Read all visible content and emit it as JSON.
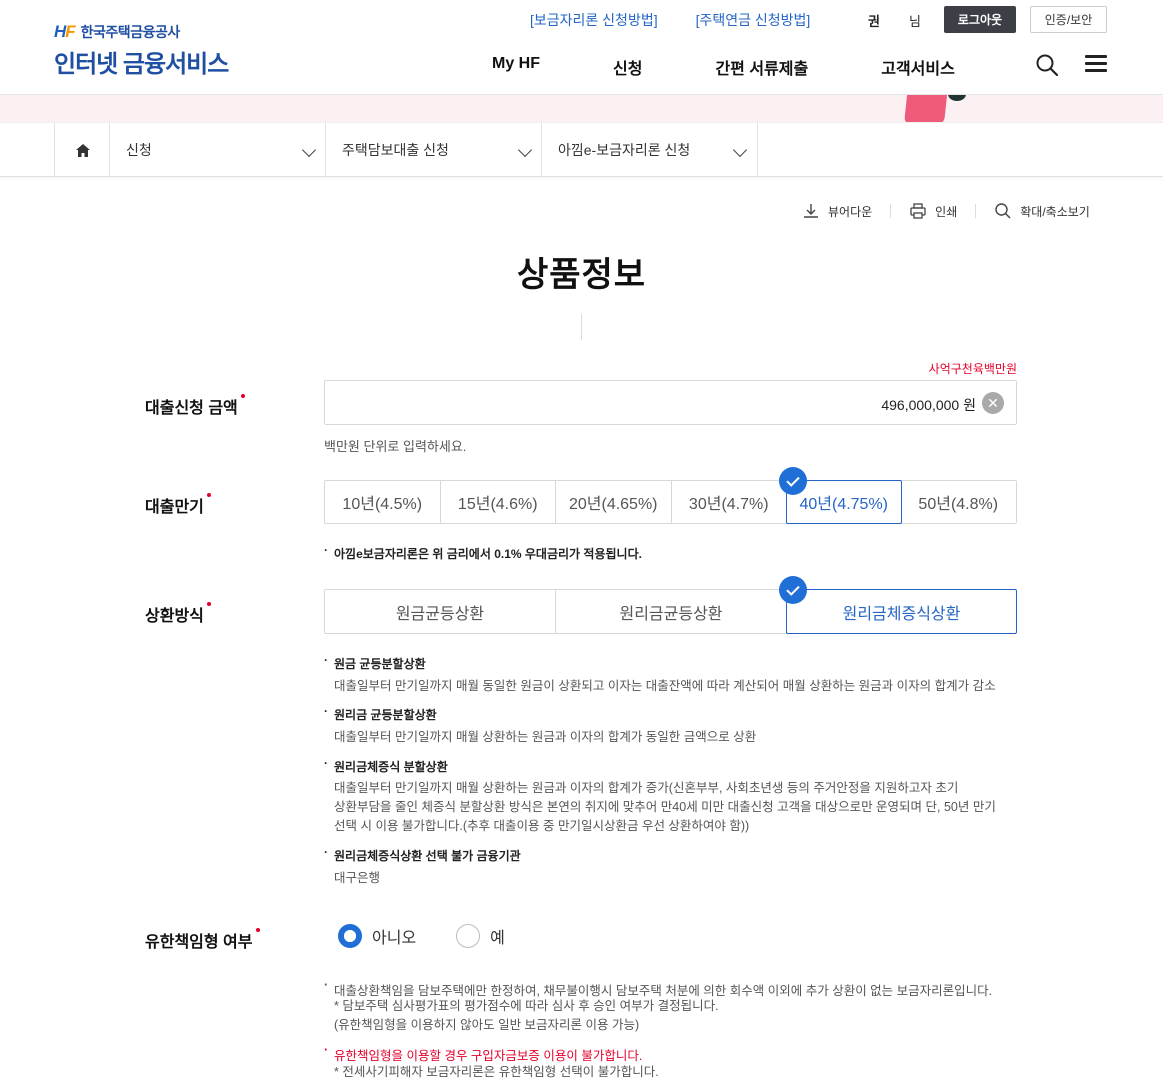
{
  "header": {
    "logo_org": "한국주택금융공사",
    "logo_main": "인터넷 금융서비스",
    "util_links": [
      "[보금자리론 신청방법]",
      "[주택연금 신청방법]"
    ],
    "user_name": "권",
    "user_suffix": "님",
    "logout_label": "로그아웃",
    "cert_label": "인증/보안",
    "gnb": [
      "My HF",
      "신청",
      "간편 서류제출",
      "고객서비스"
    ]
  },
  "breadcrumb": [
    "신청",
    "주택담보대출 신청",
    "아낌e-보금자리론 신청"
  ],
  "tools": {
    "viewer": "뷰어다운",
    "print": "인쇄",
    "zoom": "확대/축소보기"
  },
  "page_title": "상품정보",
  "loan_amount": {
    "label": "대출신청 금액",
    "korean_amount": "사억구천육백만원",
    "value": "496,000,000",
    "unit": "원",
    "helper": "백만원 단위로 입력하세요."
  },
  "term": {
    "label": "대출만기",
    "options": [
      "10년(4.5%)",
      "15년(4.6%)",
      "20년(4.65%)",
      "30년(4.7%)",
      "40년(4.75%)",
      "50년(4.8%)"
    ],
    "selected": "40년(4.75%)",
    "note": "아낌e보금자리론은 위 금리에서 0.1% 우대금리가 적용됩니다."
  },
  "repayment": {
    "label": "상환방식",
    "options": [
      "원금균등상환",
      "원리금균등상환",
      "원리금체증식상환"
    ],
    "selected": "원리금체증식상환",
    "notes": [
      {
        "title": "원금 균등분할상환",
        "desc": "대출일부터 만기일까지 매월 동일한 원금이 상환되고 이자는 대출잔액에 따라 계산되어 매월 상환하는 원금과 이자의 합계가 감소"
      },
      {
        "title": "원리금 균등분할상환",
        "desc": "대출일부터 만기일까지 매월 상환하는 원금과 이자의 합계가 동일한 금액으로 상환"
      },
      {
        "title": "원리금체증식 분할상환",
        "desc_lines": [
          "대출일부터 만기일까지 매월 상환하는 원금과 이자의 합계가 증가(신혼부부, 사회초년생 등의 주거안정을 지원하고자 초기",
          "상환부담을 줄인 체증식 분할상환 방식은 본연의 취지에 맞추어 만40세 미만 대출신청 고객을 대상으로만 운영되며 단, 50년 만기",
          "선택 시 이용 불가합니다.(추후 대출이용 중 만기일시상환금 우선 상환하여야 함))"
        ]
      },
      {
        "title": "원리금체증식상환 선택 불가 금융기관",
        "desc": "대구은행"
      }
    ]
  },
  "limited_liability": {
    "label": "유한책임형 여부",
    "options": [
      "아니오",
      "예"
    ],
    "selected": "아니오",
    "notes": [
      "대출상환책임을 담보주택에만 한정하여, 채무불이행시 담보주택 처분에 의한 회수액 이외에 추가 상환이 없는 보금자리론입니다.",
      "* 담보주택 심사평가표의 평가점수에 따라 심사 후 승인 여부가 결정됩니다.",
      "(유한책임형을 이용하지 않아도 일반 보금자리론 이용 가능)"
    ],
    "warning": "유한책임형을 이용할 경우 구입자금보증 이용이 불가합니다.",
    "warning_sub": "* 전세사기피해자 보금자리론은 유한책임형 선택이 불가합니다."
  }
}
